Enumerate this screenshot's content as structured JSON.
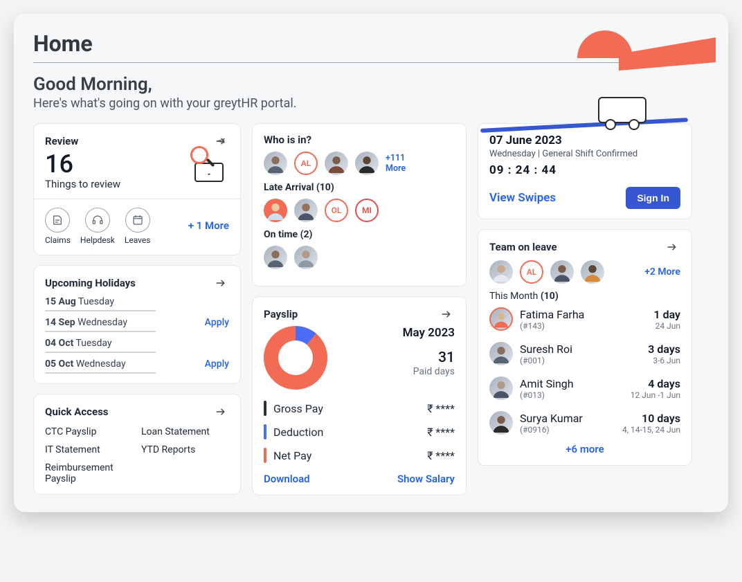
{
  "page": {
    "title": "Home",
    "greeting": "Good Morning,",
    "subtitle": "Here's what's going on with your greytHR portal."
  },
  "review": {
    "title": "Review",
    "count": "16",
    "sub": "Things to review",
    "more": "+ 1 More",
    "cats": [
      {
        "label": "Claims"
      },
      {
        "label": "Helpdesk"
      },
      {
        "label": "Leaves"
      }
    ]
  },
  "holidays": {
    "title": "Upcoming Holidays",
    "items": [
      {
        "date": "15 Aug",
        "day": "Tuesday",
        "apply": ""
      },
      {
        "date": "14 Sep",
        "day": "Wednesday",
        "apply": "Apply"
      },
      {
        "date": "04 Oct",
        "day": "Tuesday",
        "apply": ""
      },
      {
        "date": "05 Oct",
        "day": "Wednesday",
        "apply": "Apply"
      }
    ]
  },
  "quick": {
    "title": "Quick Access",
    "items": [
      "CTC Payslip",
      "Loan Statement",
      "IT Statement",
      "YTD Reports",
      "Reimbursement Payslip"
    ]
  },
  "whoisin": {
    "title": "Who is in?",
    "present_more": "+111 More",
    "present_initials": [
      "AL"
    ],
    "late_label": "Late Arrival (10)",
    "late_initials": [
      "OL",
      "MI"
    ],
    "ontime_label": "On time (2)"
  },
  "payslip": {
    "title": "Payslip",
    "month": "May 2023",
    "paid_days": "31",
    "paid_days_label": "Paid days",
    "gross_label": "Gross Pay",
    "deduct_label": "Deduction",
    "net_label": "Net Pay",
    "amount_mask": "₹ ****",
    "download": "Download",
    "show": "Show Salary"
  },
  "datecard": {
    "date": "07 June 2023",
    "shift": "Wednesday | General Shift Confirmed",
    "clock": "09 : 24 : 44",
    "view_swipes": "View Swipes",
    "signin": "Sign In"
  },
  "teamleave": {
    "title": "Team on leave",
    "top_more": "+2 More",
    "top_initials": [
      "AL"
    ],
    "month_label_pre": "This Month ",
    "month_count": "(10)",
    "people": [
      {
        "name": "Fatima Farha",
        "id": "(#143)",
        "days": "1 day",
        "range": "24 Jun"
      },
      {
        "name": "Suresh Roi",
        "id": "(#001)",
        "days": "3 days",
        "range": "3-6 Jun"
      },
      {
        "name": "Amit Singh",
        "id": "(#013)",
        "days": "4 days",
        "range": "12 Jun -1 Jun"
      },
      {
        "name": "Surya Kumar",
        "id": "(#0916)",
        "days": "10 days",
        "range": "4, 14-15, 24 Jun"
      }
    ],
    "more": "+6 more"
  }
}
